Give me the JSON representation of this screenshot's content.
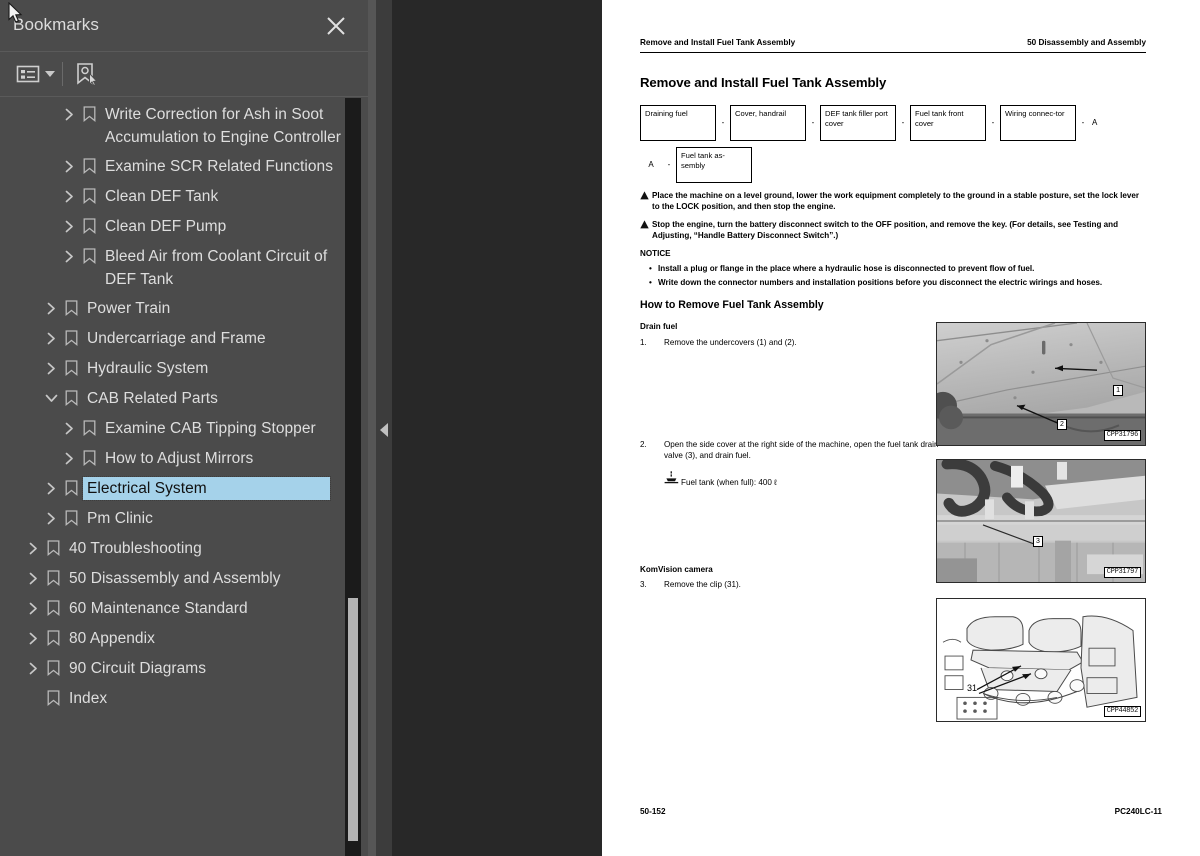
{
  "sidebar": {
    "title": "Bookmarks",
    "close_icon": "close-icon",
    "toolbar": {
      "options_icon": "list-options-icon",
      "new_bookmark_icon": "new-bookmark-icon"
    },
    "tree": [
      {
        "label": "Write Correction for Ash in Soot Accumulation to Engine Controller",
        "level": 2,
        "expandable": true,
        "expanded": false,
        "selected": false
      },
      {
        "label": "Examine SCR Related Functions",
        "level": 2,
        "expandable": true,
        "expanded": false,
        "selected": false
      },
      {
        "label": "Clean DEF Tank",
        "level": 2,
        "expandable": true,
        "expanded": false,
        "selected": false
      },
      {
        "label": "Clean DEF Pump",
        "level": 2,
        "expandable": true,
        "expanded": false,
        "selected": false
      },
      {
        "label": "Bleed Air from Coolant Circuit of DEF Tank",
        "level": 2,
        "expandable": true,
        "expanded": false,
        "selected": false
      },
      {
        "label": "Power Train",
        "level": 1,
        "expandable": true,
        "expanded": false,
        "selected": false
      },
      {
        "label": "Undercarriage and Frame",
        "level": 1,
        "expandable": true,
        "expanded": false,
        "selected": false
      },
      {
        "label": "Hydraulic System",
        "level": 1,
        "expandable": true,
        "expanded": false,
        "selected": false
      },
      {
        "label": "CAB Related Parts",
        "level": 1,
        "expandable": true,
        "expanded": true,
        "selected": false
      },
      {
        "label": "Examine CAB Tipping Stopper",
        "level": 2,
        "expandable": true,
        "expanded": false,
        "selected": false
      },
      {
        "label": "How to Adjust Mirrors",
        "level": 2,
        "expandable": true,
        "expanded": false,
        "selected": false
      },
      {
        "label": "Electrical System",
        "level": 1,
        "expandable": true,
        "expanded": false,
        "selected": true
      },
      {
        "label": "Pm Clinic",
        "level": 1,
        "expandable": true,
        "expanded": false,
        "selected": false
      },
      {
        "label": "40 Troubleshooting",
        "level": 0,
        "expandable": true,
        "expanded": false,
        "selected": false
      },
      {
        "label": "50 Disassembly and Assembly",
        "level": 0,
        "expandable": true,
        "expanded": false,
        "selected": false
      },
      {
        "label": "60 Maintenance Standard",
        "level": 0,
        "expandable": true,
        "expanded": false,
        "selected": false
      },
      {
        "label": "80 Appendix",
        "level": 0,
        "expandable": true,
        "expanded": false,
        "selected": false
      },
      {
        "label": "90 Circuit Diagrams",
        "level": 0,
        "expandable": true,
        "expanded": false,
        "selected": false
      },
      {
        "label": "Index",
        "level": 0,
        "expandable": false,
        "expanded": false,
        "selected": false
      }
    ],
    "selection_color": "#a5d2ea"
  },
  "viewer": {
    "collapse_icon": "collapse-left-arrow-icon"
  },
  "page": {
    "running_header_left": "Remove and Install Fuel Tank Assembly",
    "running_header_right": "50 Disassembly and Assembly",
    "title": "Remove and Install Fuel Tank Assembly",
    "flow": {
      "row1": [
        "Draining fuel",
        "Cover, handrail",
        "DEF tank filler port cover",
        "Fuel tank front cover",
        "Wiring connec-tor"
      ],
      "row1_end_letter": "A",
      "row2_start_letter": "A",
      "row2": [
        "Fuel tank as-sembly"
      ],
      "separator": "-"
    },
    "warnings": [
      "Place the machine on a level ground, lower the work equipment completely to the ground in a stable posture, set the lock lever to the LOCK position, and then stop the engine.",
      "Stop the engine, turn the battery disconnect switch to the OFF position, and remove the key. (For details, see Testing and Adjusting, “Handle Battery Disconnect Switch”.)"
    ],
    "notice_heading": "NOTICE",
    "notice_items": [
      "Install a plug or flange in the place where a hydraulic hose is disconnected to prevent flow of fuel.",
      "Write down the connector numbers and installation positions before you disconnect the electric wirings and hoses."
    ],
    "section_heading": "How to Remove Fuel Tank Assembly",
    "subheading_1": "Drain fuel",
    "step_1_num": "1.",
    "step_1_text": "Remove the undercovers (1) and (2).",
    "step_2_num": "2.",
    "step_2_text": "Open the side cover at the right side of the machine, open the fuel tank drain valve (3), and drain fuel.",
    "capacity_icon": "fill-drain-icon",
    "capacity_text": "Fuel tank (when full): 400 ℓ",
    "subheading_2": "KomVision camera",
    "step_3_num": "3.",
    "step_3_text": "Remove the clip (31).",
    "figures": [
      {
        "code": "CPP31796",
        "callouts": [
          "1",
          "2"
        ]
      },
      {
        "code": "CPP31797",
        "callouts": [
          "3"
        ]
      },
      {
        "code": "CPP44852",
        "callouts": [
          "31"
        ]
      }
    ],
    "footer_left": "50-152",
    "footer_right": "PC240LC-11"
  }
}
